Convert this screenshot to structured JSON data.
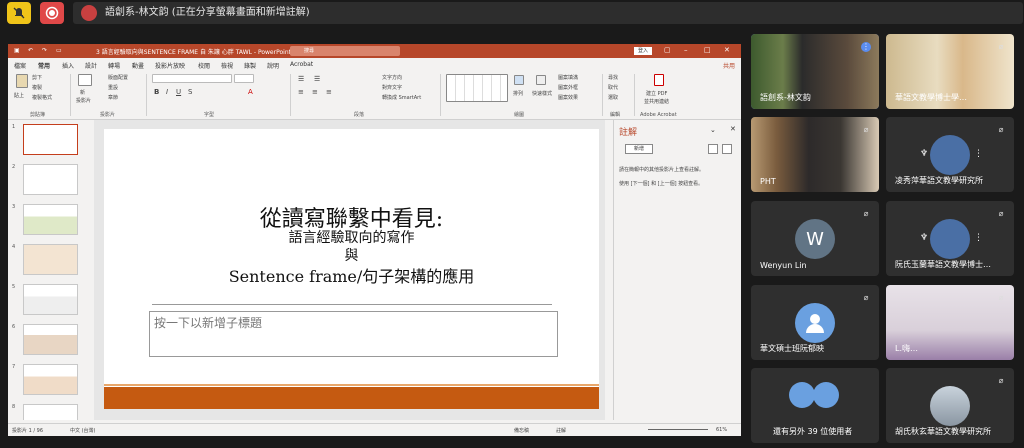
{
  "share_banner": "語創系-林文韵 (正在分享螢幕畫面和新增註解)",
  "colors": {
    "accent": "#b7472a",
    "record": "#e04848",
    "notify": "#f0c419",
    "slide_bar": "#c55a11",
    "speaker": "#5b8def"
  },
  "ppt": {
    "title": "3 語言經驗取向與SENTENCE FRAME 自 朱讓 心胖 TAWL - PowerPoint",
    "search": "搜尋",
    "signin": "登入",
    "menu": [
      "檔案",
      "常用",
      "插入",
      "設計",
      "轉場",
      "動畫",
      "投影片放映",
      "校閱",
      "檢視",
      "錄製",
      "說明",
      "Acrobat"
    ],
    "share": "共用",
    "ribbon": {
      "groups": [
        "剪貼簿",
        "投影片",
        "字型",
        "段落",
        "繪圖",
        "編輯",
        "Adobe Acrobat"
      ],
      "clipboard": [
        "貼上",
        "剪下",
        "複製",
        "複製格式"
      ],
      "slides": [
        "新",
        "投影片",
        "版面配置",
        "重設",
        "章節"
      ],
      "editing": [
        "尋找",
        "取代",
        "選取"
      ],
      "acrobat": [
        "建立 PDF",
        "並共用連結"
      ],
      "drawing": [
        "排列",
        "快速樣式",
        "圖案填滿",
        "圖案外框",
        "圖案效果"
      ],
      "paragraph": [
        "文字方向",
        "對齊文字",
        "轉換成 SmartArt"
      ]
    },
    "slide_numbers": [
      "1",
      "2",
      "3",
      "4",
      "5",
      "6",
      "7",
      "8"
    ],
    "slide": {
      "title": "從讀寫聯繫中看見:",
      "line2": "語言經驗取向的寫作",
      "line3": "與",
      "line4": "Sentence frame/句子架構的應用",
      "subtitle_placeholder": "按一下以新增子標題"
    },
    "notes": {
      "title": "註解",
      "new": "新增",
      "hint1": "請在簡報中的其他投影片上查看註解。",
      "hint2": "使用 [下一個] 和 [上一個] 按鈕查看。"
    },
    "status": {
      "slide": "投影片 1 / 96",
      "lang": "中文 (台灣)",
      "notes": "備忘稿",
      "comments": "註解",
      "zoom": "61%"
    }
  },
  "participants": [
    {
      "name": "語創系-林文韵"
    },
    {
      "name": "華語文教學博士學…"
    },
    {
      "name": "PHT"
    },
    {
      "name": "凌秀萍華語文教學研究所"
    },
    {
      "name": "Wenyun Lin",
      "initial": "W"
    },
    {
      "name": "阮氏玉蘭華語文教學博士…"
    },
    {
      "name": "華文碩士班阮郁映"
    },
    {
      "name": "L.嗨…"
    },
    {
      "name": "還有另外 39 位使用者"
    },
    {
      "name": "胡氏秋玄華語文教學研究所"
    }
  ]
}
